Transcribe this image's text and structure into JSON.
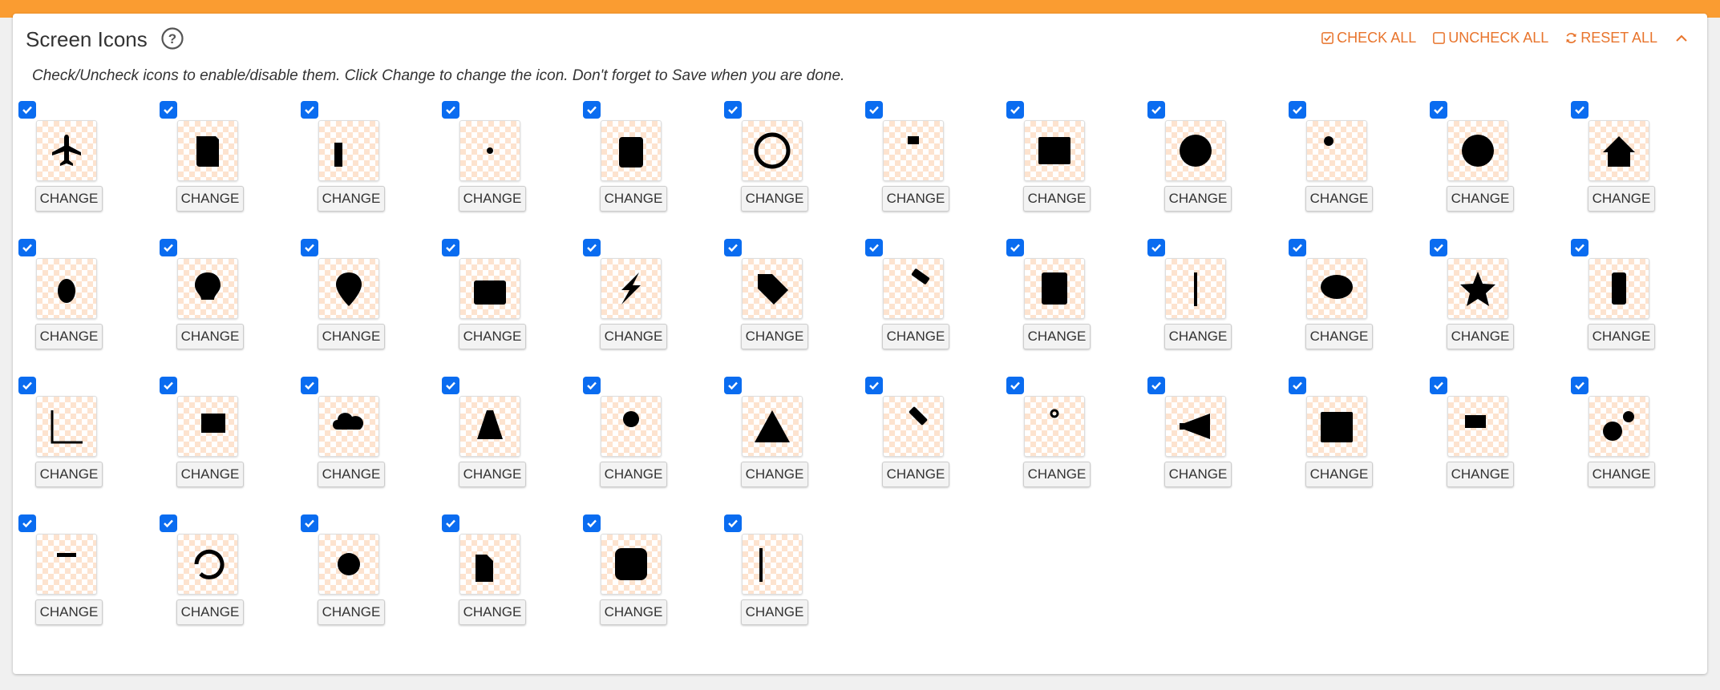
{
  "header": {
    "title": "Screen Icons",
    "check_all": "CHECK ALL",
    "uncheck_all": "UNCHECK ALL",
    "reset_all": "RESET ALL"
  },
  "description": "Check/Uncheck icons to enable/disable them. Click Change to change the icon. Don't forget to Save when you are done.",
  "colors": {
    "accent": "#e8742c",
    "top_bar": "#fa9c31",
    "checkbox": "#0a6cf0"
  },
  "change_label": "CHANGE",
  "icons": [
    {
      "name": "airplane-icon",
      "checked": true
    },
    {
      "name": "book-icon",
      "checked": true
    },
    {
      "name": "buildings-icon",
      "checked": true
    },
    {
      "name": "atom-icon",
      "checked": true
    },
    {
      "name": "clipboard-icon",
      "checked": true
    },
    {
      "name": "clock-icon",
      "checked": true
    },
    {
      "name": "sitemap-icon",
      "checked": true
    },
    {
      "name": "id-card-icon",
      "checked": true
    },
    {
      "name": "globe-icon",
      "checked": true
    },
    {
      "name": "users-icon",
      "checked": true
    },
    {
      "name": "life-ring-icon",
      "checked": true
    },
    {
      "name": "house-icon",
      "checked": true
    },
    {
      "name": "bug-icon",
      "checked": true
    },
    {
      "name": "lightbulb-icon",
      "checked": true
    },
    {
      "name": "map-marker-icon",
      "checked": true
    },
    {
      "name": "medkit-icon",
      "checked": true
    },
    {
      "name": "lightning-icon",
      "checked": true
    },
    {
      "name": "tag-icon",
      "checked": true
    },
    {
      "name": "paint-roller-icon",
      "checked": true
    },
    {
      "name": "address-book-icon",
      "checked": true
    },
    {
      "name": "signpost-icon",
      "checked": true
    },
    {
      "name": "speech-bubble-icon",
      "checked": true
    },
    {
      "name": "star-icon",
      "checked": true
    },
    {
      "name": "traffic-light-icon",
      "checked": true
    },
    {
      "name": "bar-chart-icon",
      "checked": true
    },
    {
      "name": "truck-icon",
      "checked": true
    },
    {
      "name": "rain-cloud-icon",
      "checked": true
    },
    {
      "name": "traffic-cone-icon",
      "checked": true
    },
    {
      "name": "user-icon",
      "checked": true
    },
    {
      "name": "warning-icon",
      "checked": true
    },
    {
      "name": "gavel-icon",
      "checked": true
    },
    {
      "name": "anchor-icon",
      "checked": true
    },
    {
      "name": "megaphone-icon",
      "checked": true
    },
    {
      "name": "calendar-icon",
      "checked": true
    },
    {
      "name": "drill-icon",
      "checked": true
    },
    {
      "name": "gears-icon",
      "checked": true
    },
    {
      "name": "menu-icon",
      "checked": true
    },
    {
      "name": "history-icon",
      "checked": true
    },
    {
      "name": "gear-icon",
      "checked": true
    },
    {
      "name": "files-icon",
      "checked": true
    },
    {
      "name": "info-icon",
      "checked": true
    },
    {
      "name": "flag-icon",
      "checked": true
    }
  ]
}
